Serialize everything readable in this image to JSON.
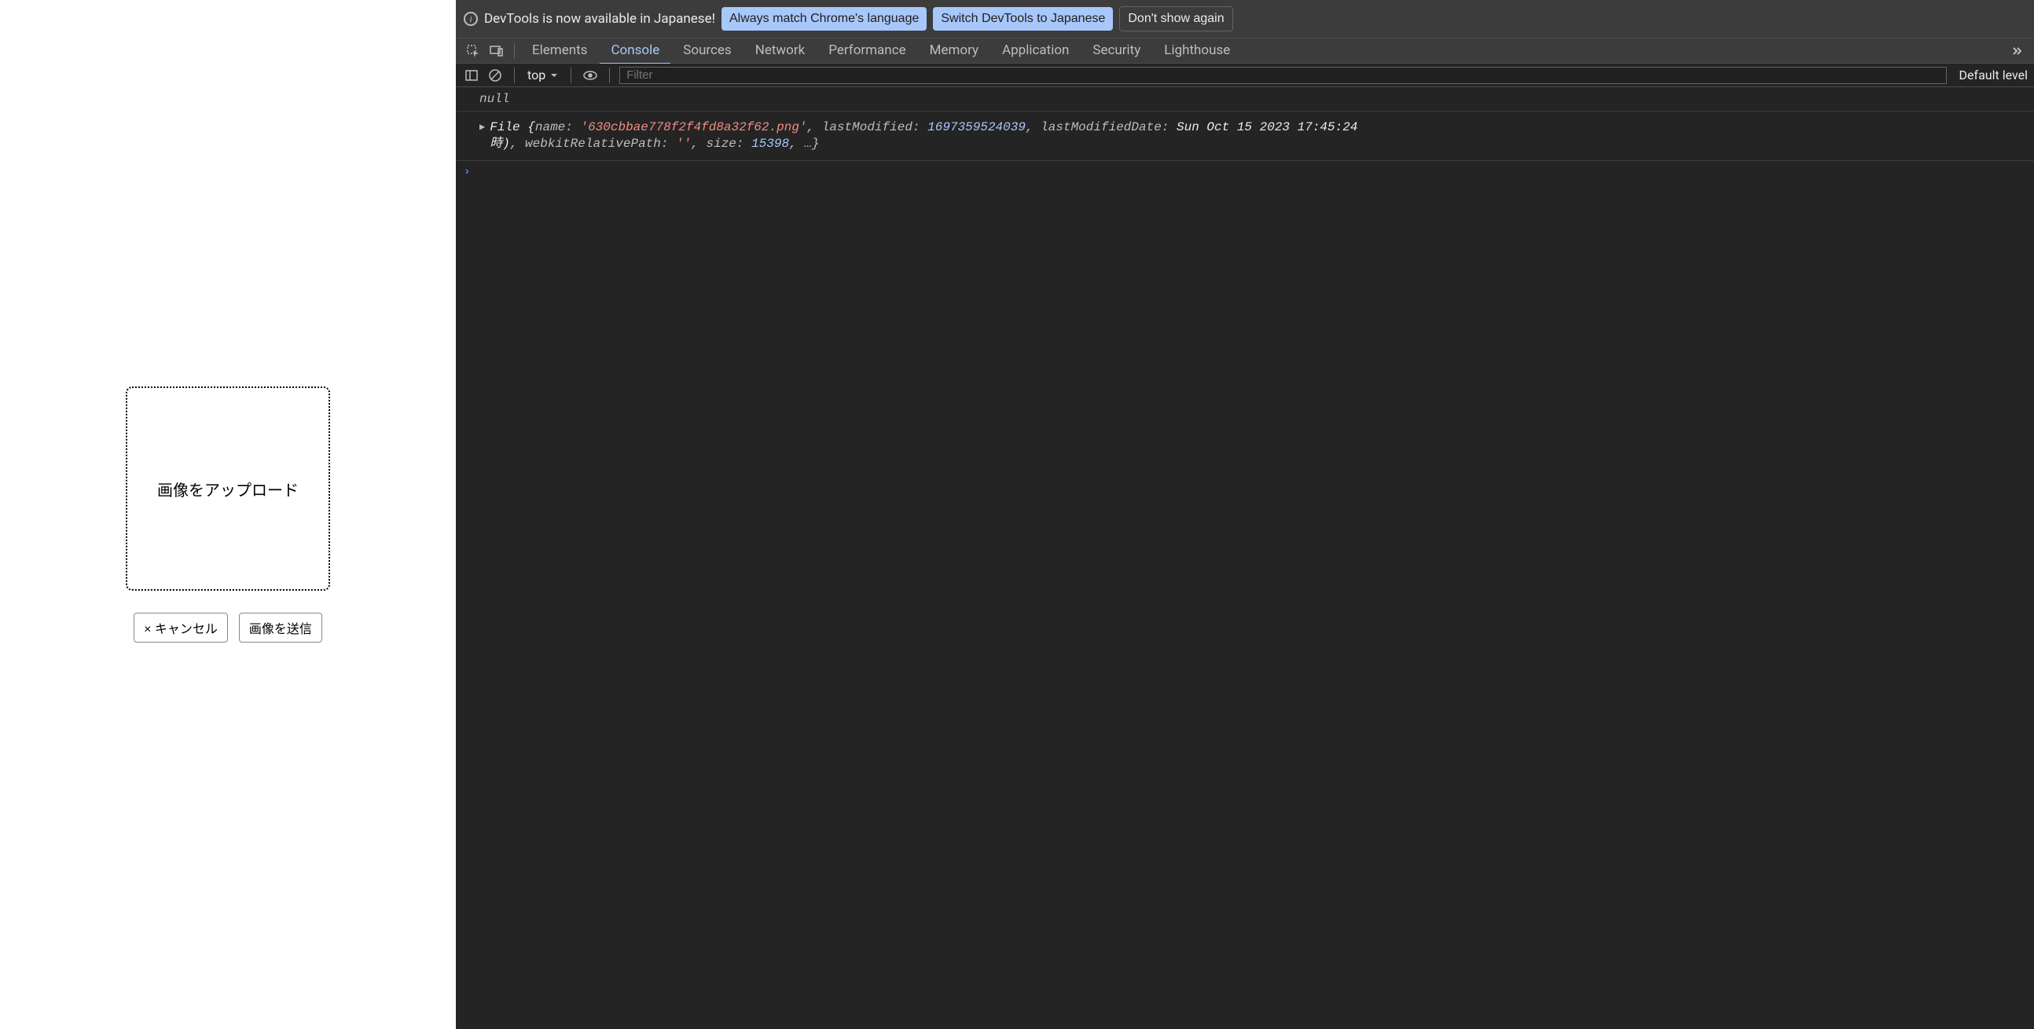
{
  "page": {
    "upload_label": "画像をアップロード",
    "cancel_btn": "× キャンセル",
    "submit_btn": "画像を送信"
  },
  "infobar": {
    "message": "DevTools is now available in Japanese!",
    "always_match": "Always match Chrome's language",
    "switch_lang": "Switch DevTools to Japanese",
    "dont_show": "Don't show again"
  },
  "tabs": {
    "elements": "Elements",
    "console": "Console",
    "sources": "Sources",
    "network": "Network",
    "performance": "Performance",
    "memory": "Memory",
    "application": "Application",
    "security": "Security",
    "lighthouse": "Lighthouse"
  },
  "toolbar": {
    "context": "top",
    "filter_placeholder": "Filter",
    "default_levels": "Default level"
  },
  "console": {
    "line1": "null",
    "obj_type": "File",
    "prop_name": "name",
    "val_name": "'630cbbae778f2f4fd8a32f62.png'",
    "prop_lm": "lastModified",
    "val_lm": "1697359524039",
    "prop_lmd": "lastModifiedDate",
    "val_lmd": "Sun Oct 15 2023 17:45:24",
    "line2_tail": "時)",
    "prop_wrp": "webkitRelativePath",
    "val_wrp": "''",
    "prop_size": "size",
    "val_size": "15398",
    "ellipsis": ", …}"
  }
}
